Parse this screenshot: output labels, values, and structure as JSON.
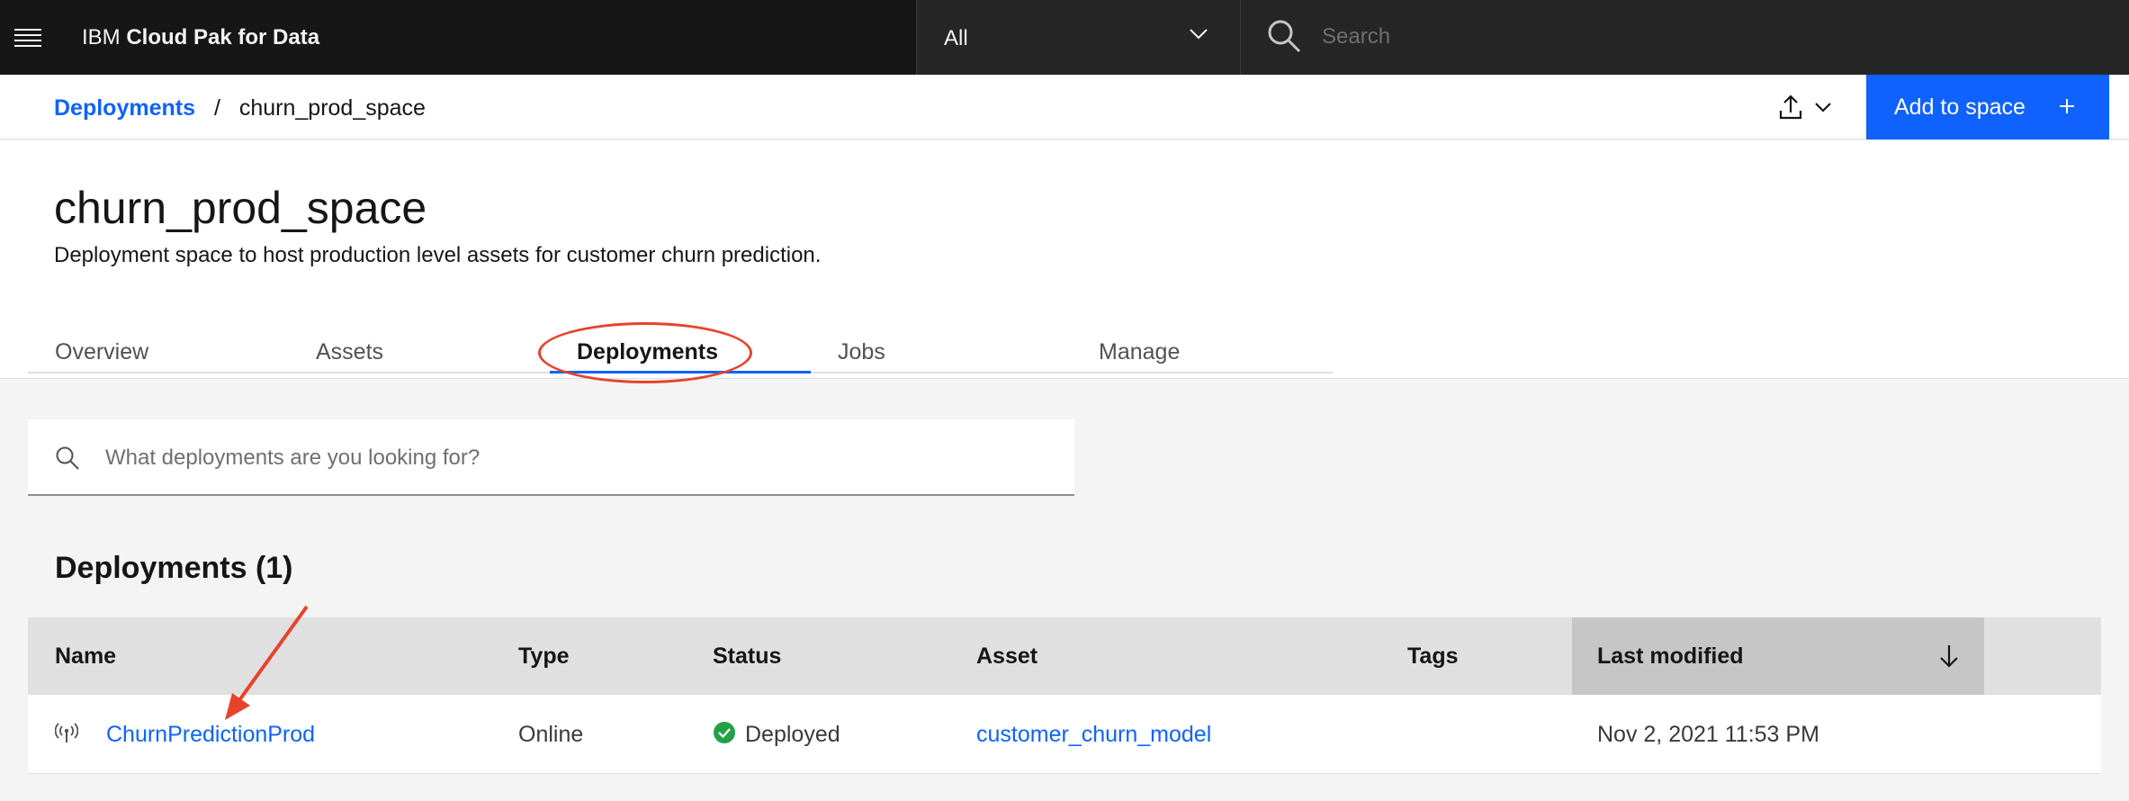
{
  "topbar": {
    "brand_prefix": "IBM",
    "brand_name": "Cloud Pak for Data",
    "scope_selected": "All",
    "search_placeholder": "Search"
  },
  "header": {
    "breadcrumb_link": "Deployments",
    "breadcrumb_separator": "/",
    "breadcrumb_current": "churn_prod_space",
    "add_button_label": "Add to space"
  },
  "page": {
    "title": "churn_prod_space",
    "description": "Deployment space to host production level assets for customer churn prediction."
  },
  "tabs": [
    {
      "label": "Overview"
    },
    {
      "label": "Assets"
    },
    {
      "label": "Deployments"
    },
    {
      "label": "Jobs"
    },
    {
      "label": "Manage"
    }
  ],
  "search": {
    "placeholder": "What deployments are you looking for?"
  },
  "deployments": {
    "section_title": "Deployments (1)",
    "columns": [
      "Name",
      "Type",
      "Status",
      "Asset",
      "Tags",
      "Last modified"
    ],
    "rows": [
      {
        "name": "ChurnPredictionProd",
        "type": "Online",
        "status": "Deployed",
        "asset": "customer_churn_model",
        "tags": "",
        "last_modified": "Nov 2, 2021 11:53 PM"
      }
    ]
  },
  "colors": {
    "accent": "#0f62fe",
    "topbar_bg": "#161616",
    "status_success": "#24a148",
    "annotation": "#e5442b"
  },
  "icons": [
    "hamburger-menu-icon",
    "chevron-down-icon",
    "search-icon",
    "upload-icon",
    "add-icon",
    "deployment-online-icon",
    "checkmark-filled-icon",
    "arrow-down-icon"
  ]
}
